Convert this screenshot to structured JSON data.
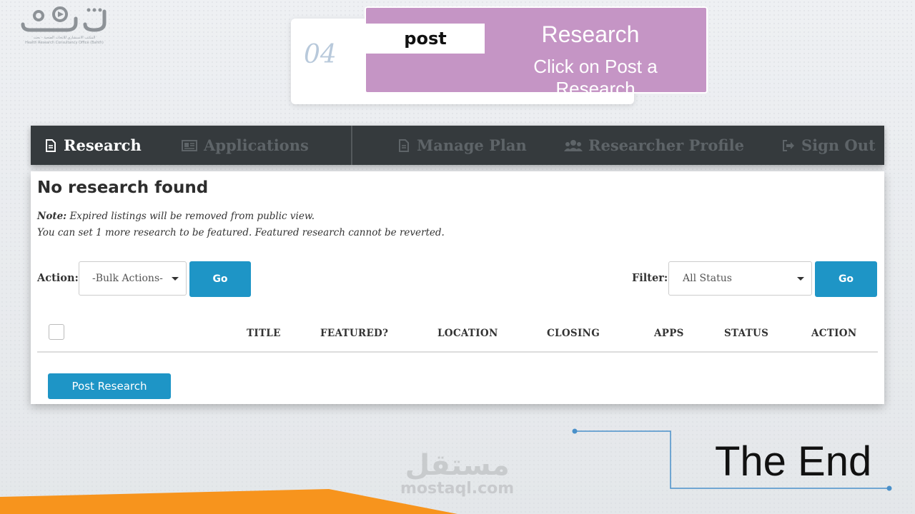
{
  "logo": {
    "mark_text": "بحث",
    "tagline": "المكتب الاستشاري للأبحاث الصحية - بحث",
    "tagline_en": "Health Research Consultancy Office (Bahth)"
  },
  "step": {
    "number": "04",
    "keyword": "post",
    "title": "Research",
    "subtitle": "Click on Post a Research",
    "banner_color": "#c595c5"
  },
  "nav": {
    "items": [
      {
        "label": "Research",
        "icon": "document-icon",
        "active": true
      },
      {
        "label": "Applications",
        "icon": "id-card-icon",
        "active": false
      },
      {
        "label": "Manage Plan",
        "icon": "document-icon",
        "active": false
      },
      {
        "label": "Researcher Profile",
        "icon": "users-icon",
        "active": false
      },
      {
        "label": "Sign Out",
        "icon": "sign-out-icon",
        "active": false
      }
    ]
  },
  "panel": {
    "title": "No research found",
    "note_label": "Note:",
    "note_text": "Expired listings will be removed from public view.",
    "note_line2": "You can set 1 more research to be featured. Featured research cannot be reverted.",
    "action_label": "Action:",
    "bulk_select": "-Bulk Actions-",
    "go_label": "Go",
    "filter_label": "Filter:",
    "filter_select": "All Status",
    "go2_label": "Go",
    "columns": [
      "TITLE",
      "FEATURED?",
      "LOCATION",
      "CLOSING",
      "APPS",
      "STATUS",
      "ACTION"
    ],
    "post_button": "Post Research"
  },
  "ending": {
    "text": "The End"
  },
  "watermark": {
    "arabic": "مستقل",
    "latin": "mostaql.com"
  },
  "colors": {
    "accent": "#1e95c6",
    "nav_bg": "#353a3d",
    "orange": "#f7941d"
  }
}
